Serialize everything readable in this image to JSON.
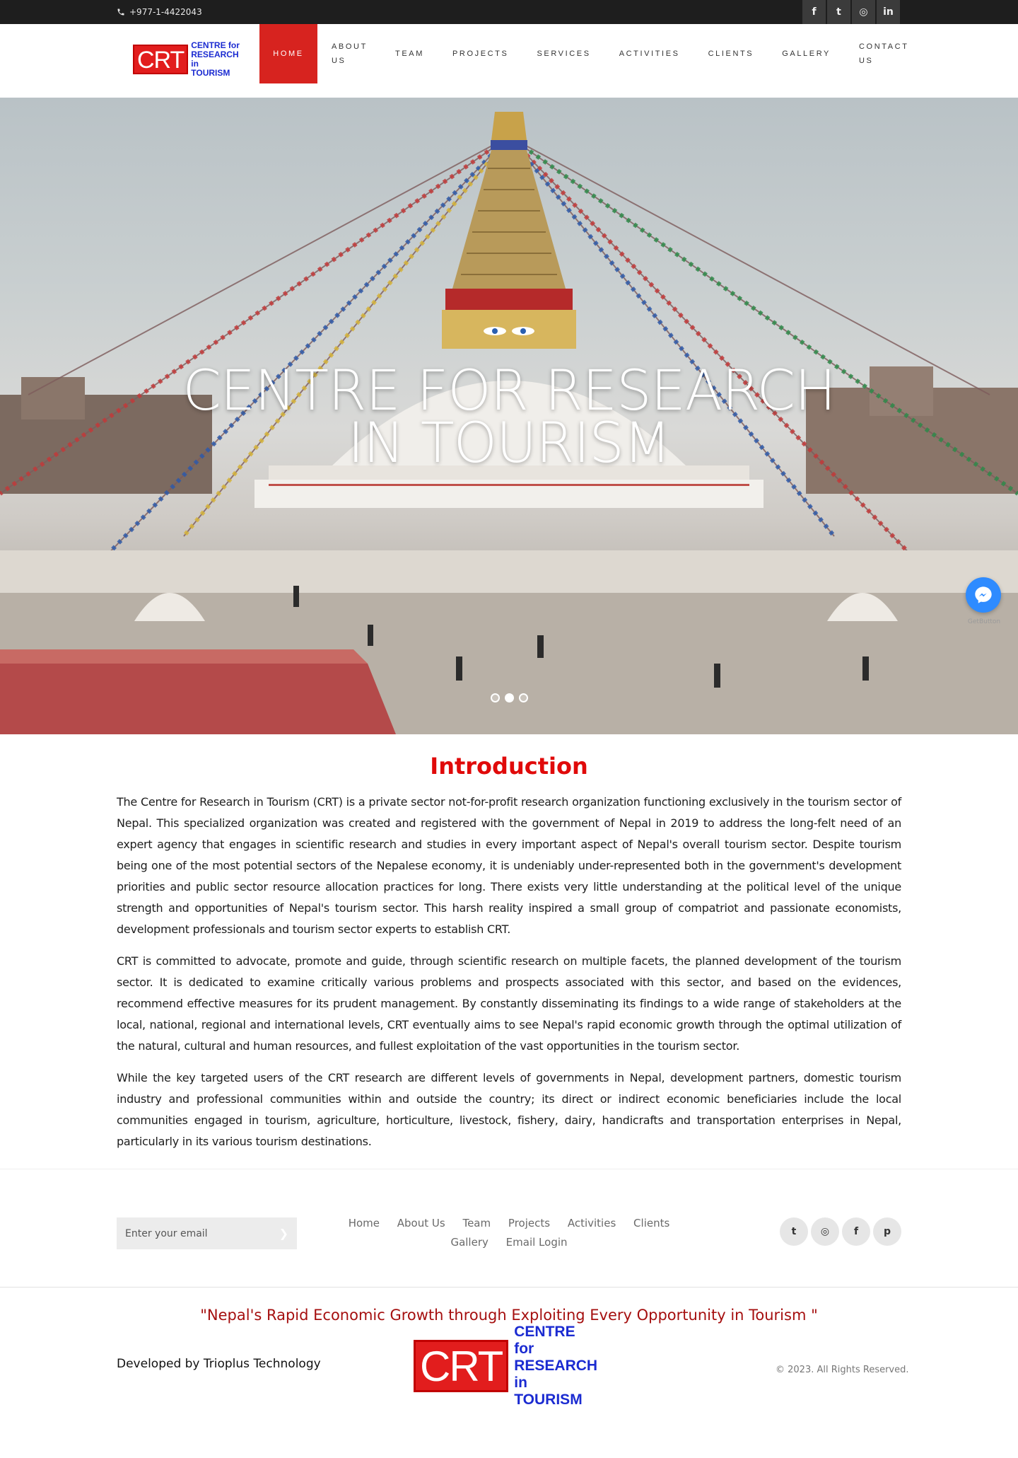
{
  "topbar": {
    "phone": "+977-1-4422043",
    "socials": [
      {
        "icon": "facebook-icon",
        "glyph": "f"
      },
      {
        "icon": "twitter-icon",
        "glyph": "t"
      },
      {
        "icon": "instagram-icon",
        "glyph": "◎"
      },
      {
        "icon": "linkedin-icon",
        "glyph": "in"
      }
    ]
  },
  "header": {
    "logo": {
      "mark": "CRT",
      "line1": "CENTRE for",
      "line2": "RESEARCH in",
      "line3": "TOURISM"
    },
    "nav": [
      {
        "label": "HOME",
        "active": true
      },
      {
        "label": "ABOUT US"
      },
      {
        "label": "TEAM"
      },
      {
        "label": "PROJECTS"
      },
      {
        "label": "SERVICES"
      },
      {
        "label": "ACTIVITIES"
      },
      {
        "label": "CLIENTS"
      },
      {
        "label": "GALLERY"
      },
      {
        "label": "CONTACT US"
      }
    ]
  },
  "hero": {
    "title_line1": "CENTRE FOR RESEARCH",
    "title_line2": "IN TOURISM",
    "slides": 3,
    "active_slide": 2,
    "messenger_label": "GetButton"
  },
  "intro": {
    "title": "Introduction",
    "paragraphs": [
      "The Centre for Research in Tourism (CRT) is a private sector not-for-profit research organization functioning exclusively in the tourism sector of Nepal. This specialized organization was created and registered with the government of Nepal in 2019 to address the long-felt need of an expert agency that engages in scientific research and studies in every important aspect of Nepal's overall tourism sector. Despite tourism being one of the most potential sectors of the Nepalese economy, it is undeniably under-represented both in the government's development priorities and public sector resource allocation practices for long. There exists very little understanding at the political level of the unique strength and opportunities of Nepal's tourism sector. This harsh reality inspired a small group of compatriot and passionate economists, development professionals and tourism sector experts to establish CRT.",
      "CRT is committed to advocate, promote and guide, through scientific research on multiple facets, the planned development of the tourism sector. It is dedicated to examine critically various problems and prospects associated with this sector, and based on the evidences, recommend effective measures for its prudent management. By constantly disseminating its findings to a wide range of stakeholders at the local, national, regional and international levels, CRT eventually aims to see Nepal's rapid economic growth through the optimal utilization of the natural, cultural and human resources, and fullest exploitation of the vast opportunities in the tourism sector.",
      "While the key targeted users of the CRT research are different levels of governments in Nepal, development partners, domestic tourism industry and professional communities within and outside the country; its direct or indirect economic beneficiaries include the local communities engaged in tourism, agriculture, horticulture, livestock, fishery, dairy, handicrafts and transportation enterprises in Nepal, particularly in its various tourism destinations."
    ]
  },
  "footer": {
    "email_placeholder": "Enter your email",
    "links": [
      "Home",
      "About Us",
      "Team",
      "Projects",
      "Activities",
      "Clients",
      "Gallery",
      "Email Login"
    ],
    "socials": [
      {
        "icon": "twitter-icon",
        "glyph": "t"
      },
      {
        "icon": "instagram-icon",
        "glyph": "◎"
      },
      {
        "icon": "facebook-icon",
        "glyph": "f"
      },
      {
        "icon": "pinterest-icon",
        "glyph": "p"
      }
    ],
    "tagline": "\"Nepal's Rapid Economic Growth through Exploiting Every Opportunity in Tourism \"",
    "developer": "Developed by Trioplus Technology",
    "copyright": "© 2023. All Rights Reserved.",
    "logo": {
      "mark": "CRT",
      "line1": "CENTRE for",
      "line2": "RESEARCH in",
      "line3": "TOURISM"
    }
  }
}
